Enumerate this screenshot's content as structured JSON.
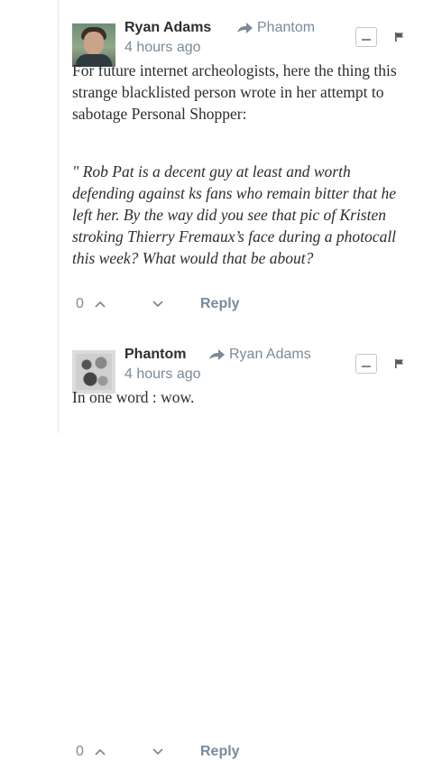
{
  "comments": [
    {
      "author": "Ryan Adams",
      "reply_to": "Phantom",
      "time": "4 hours ago",
      "paragraphs": [
        "For future internet archeologists, here the thing this strange blacklisted person wrote in her attempt to sabotage Personal Shopper:",
        "\" Rob Pat is a decent guy at least and worth defending against ks fans who remain bitter that he left her. By the way did you see that pic of Kristen stroking Thierry Fremaux’s face during a photocall this week? What would that be about?"
      ],
      "votes": "0",
      "reply_label": "Reply"
    },
    {
      "author": "Phantom",
      "reply_to": "Ryan Adams",
      "time": "4 hours ago",
      "paragraphs": [
        "In one word : wow."
      ],
      "votes": "0",
      "reply_label": "Reply"
    }
  ],
  "icons": {
    "reply_arrow": "share-arrow-icon",
    "collapse": "minus-box-icon",
    "flag": "flag-icon",
    "upvote": "chevron-up-icon",
    "downvote": "chevron-down-icon"
  }
}
